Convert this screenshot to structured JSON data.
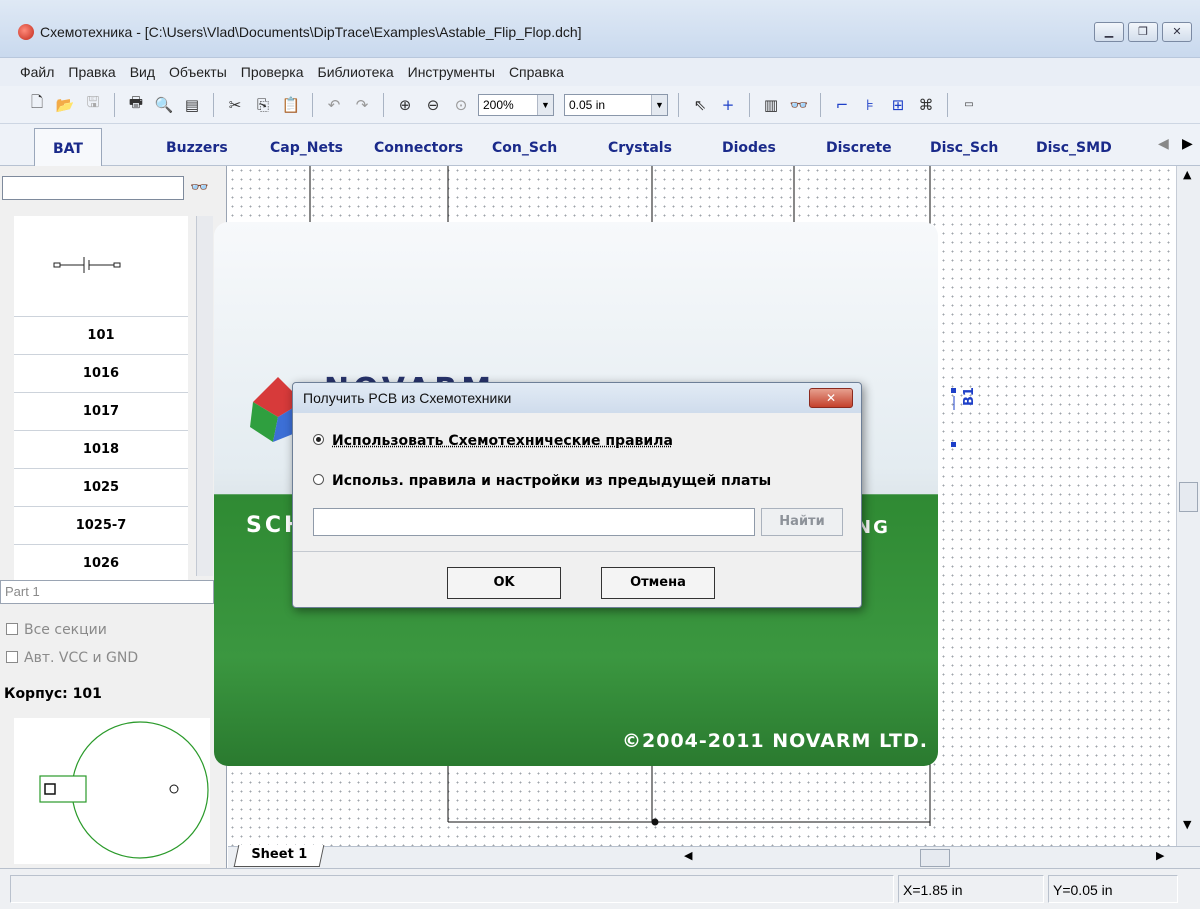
{
  "window": {
    "title": "Схемотехника - [C:\\Users\\Vlad\\Documents\\DipTrace\\Examples\\Astable_Flip_Flop.dch]",
    "app_icon": "diptrace-app-icon",
    "controls": [
      "minimize-icon",
      "restore-icon",
      "close-icon"
    ]
  },
  "menu": [
    "Файл",
    "Правка",
    "Вид",
    "Объекты",
    "Проверка",
    "Библиотека",
    "Инструменты",
    "Справка"
  ],
  "toolbar": {
    "zoom_value": "200%",
    "grid_value": "0.05 in",
    "icons": [
      "new-icon",
      "open-icon",
      "save-icon",
      "print-icon",
      "print-preview-icon",
      "report-icon",
      "cut-icon",
      "copy-icon",
      "paste-icon",
      "undo-icon",
      "redo-icon",
      "zoom-in-icon",
      "zoom-out-icon",
      "zoom-fit-icon",
      "pointer-icon",
      "place-wire-icon",
      "component-icon",
      "find-icon",
      "net-icon",
      "bus-icon",
      "hierarchy-icon",
      "part-editor-icon",
      "ic-icon"
    ]
  },
  "library_tabs": [
    "BAT",
    "Buzzers",
    "Cap_Nets",
    "Connectors",
    "Con_Sch",
    "Crystals",
    "Diodes",
    "Discrete",
    "Disc_Sch",
    "Disc_SMD"
  ],
  "left_panel": {
    "search_value": "",
    "parts": [
      "101",
      "1016",
      "1017",
      "1018",
      "1025",
      "1025-7",
      "1026"
    ],
    "part_select": "Part 1",
    "all_sections": "Все секции",
    "auto_vcc_gnd": "Авт. VCC и GND",
    "package_label": "Корпус: 101"
  },
  "canvas": {
    "component_ref": "B1",
    "sheet_tab": "Sheet 1"
  },
  "status": {
    "x": "X=1.85 in",
    "y": "Y=0.05 in"
  },
  "splash": {
    "brand": "NOVARM",
    "band_left": "SCH",
    "band_right": "NG",
    "copyright": "©2004-2011 NOVARM LTD."
  },
  "dialog": {
    "title": "Получить PCB из Схемотехники",
    "option1": "Использовать Схемотехнические правила",
    "option2": "Использ. правила и настройки из предыдущей платы",
    "selected_option": 1,
    "path_value": "",
    "find_label": "Найти",
    "ok_label": "OK",
    "cancel_label": "Отмена"
  }
}
